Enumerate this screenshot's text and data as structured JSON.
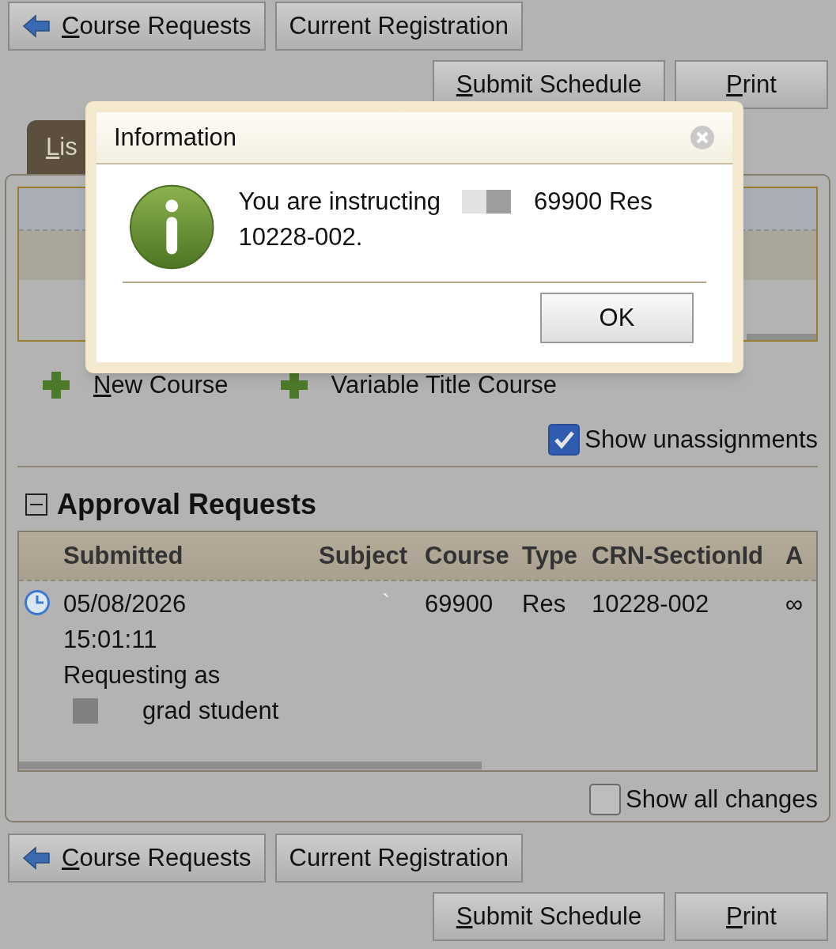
{
  "toolbar_top": {
    "nav": [
      {
        "kind": "back",
        "mnemonic": "C",
        "label": "ourse Requests"
      },
      {
        "kind": "plain",
        "label": "Current Registration"
      }
    ],
    "actions": [
      {
        "mnemonic": "S",
        "label": "ubmit Schedule"
      },
      {
        "mnemonic": "P",
        "label": "rint"
      }
    ]
  },
  "tabs": [
    {
      "mnemonic": "L",
      "label": "is",
      "selected": true
    }
  ],
  "links": [
    {
      "mnemonic": "N",
      "label": "ew Course"
    },
    {
      "label": "Variable Title Course"
    }
  ],
  "show_unassignments": {
    "label": "Show unassignments",
    "checked": true
  },
  "approval_requests": {
    "title": "Approval Requests",
    "expanded": true,
    "columns": [
      "Submitted",
      "Subject",
      "Course",
      "Type",
      "CRN-SectionId",
      "A"
    ],
    "rows": [
      {
        "date": "05/08/2026",
        "time": "15:01:11",
        "requesting": "Requesting as",
        "role": "grad student",
        "subject": "`",
        "course": "69900",
        "type": "Res",
        "crn": "10228-002",
        "column_6": "∞"
      }
    ]
  },
  "show_all_changes": {
    "label": "Show all changes",
    "checked": false
  },
  "toolbar_bottom": {
    "nav": [
      {
        "kind": "back",
        "mnemonic": "C",
        "label": "ourse Requests"
      },
      {
        "kind": "plain",
        "label": "Current Registration"
      }
    ],
    "actions": [
      {
        "mnemonic": "S",
        "label": "ubmit Schedule"
      },
      {
        "mnemonic": "P",
        "label": "rint"
      }
    ]
  },
  "dialog": {
    "title": "Information",
    "message_start": "You are instructing",
    "message_end": "69900 Res",
    "message_line2": "10228-002.",
    "button": "OK"
  }
}
